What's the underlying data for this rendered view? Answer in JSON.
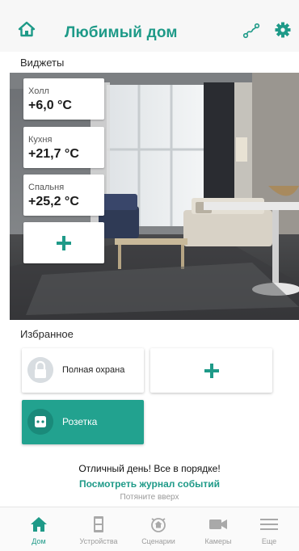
{
  "header": {
    "title": "Любимый дом",
    "home_icon": "home-icon",
    "route_icon": "route-icon",
    "settings_icon": "gear-icon"
  },
  "widgets_section": {
    "label": "Виджеты",
    "items": [
      {
        "name": "Холл",
        "value": "+6,0 °C"
      },
      {
        "name": "Кухня",
        "value": "+21,7 °C"
      },
      {
        "name": "Спальня",
        "value": "+25,2 °C"
      }
    ]
  },
  "favorites_section": {
    "label": "Избранное",
    "items": [
      {
        "label": "Полная охрана",
        "icon": "lock-icon"
      },
      {
        "label": "Розетка",
        "icon": "socket-icon"
      }
    ]
  },
  "status": {
    "message": "Отличный день! Все в порядке!",
    "link": "Посмотреть журнал событий",
    "hint": "Потяните вверх"
  },
  "nav": {
    "items": [
      {
        "label": "Дом",
        "icon": "home-icon",
        "active": true
      },
      {
        "label": "Устройства",
        "icon": "devices-icon",
        "active": false
      },
      {
        "label": "Сценарии",
        "icon": "scenarios-icon",
        "active": false
      },
      {
        "label": "Камеры",
        "icon": "camera-icon",
        "active": false
      },
      {
        "label": "Еще",
        "icon": "menu-icon",
        "active": false
      }
    ]
  },
  "colors": {
    "accent": "#1e9a88",
    "socket_card": "#22a28f",
    "inactive_nav": "#9c9c9c"
  }
}
